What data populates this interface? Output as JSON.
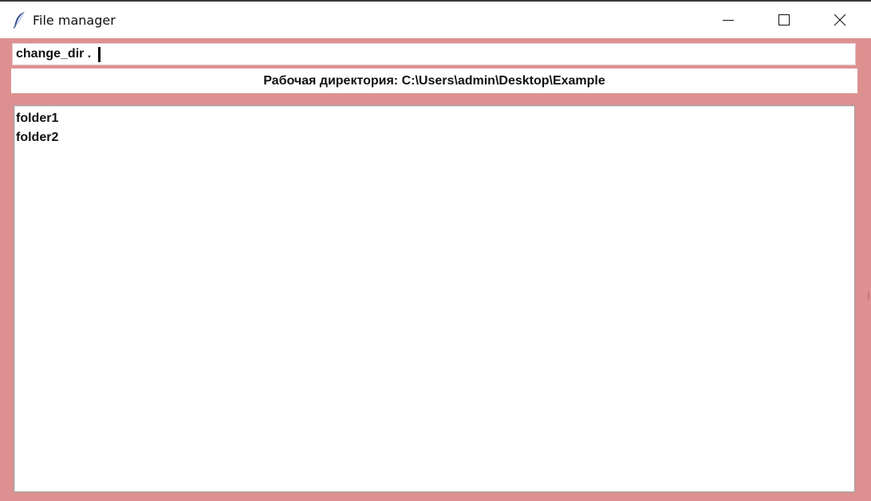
{
  "window": {
    "title": "File manager",
    "app_icon": "feather-icon",
    "controls": [
      "minimize-icon",
      "maximize-icon",
      "close-icon"
    ]
  },
  "command_input": {
    "value": "change_dir ."
  },
  "working_directory": {
    "text": "Рабочая директория: C:\\Users\\admin\\Desktop\\Example"
  },
  "file_list": {
    "items": [
      "folder1",
      "folder2"
    ]
  },
  "colors": {
    "background": "#dc9190",
    "panel": "#ffffff",
    "text": "#111111"
  }
}
